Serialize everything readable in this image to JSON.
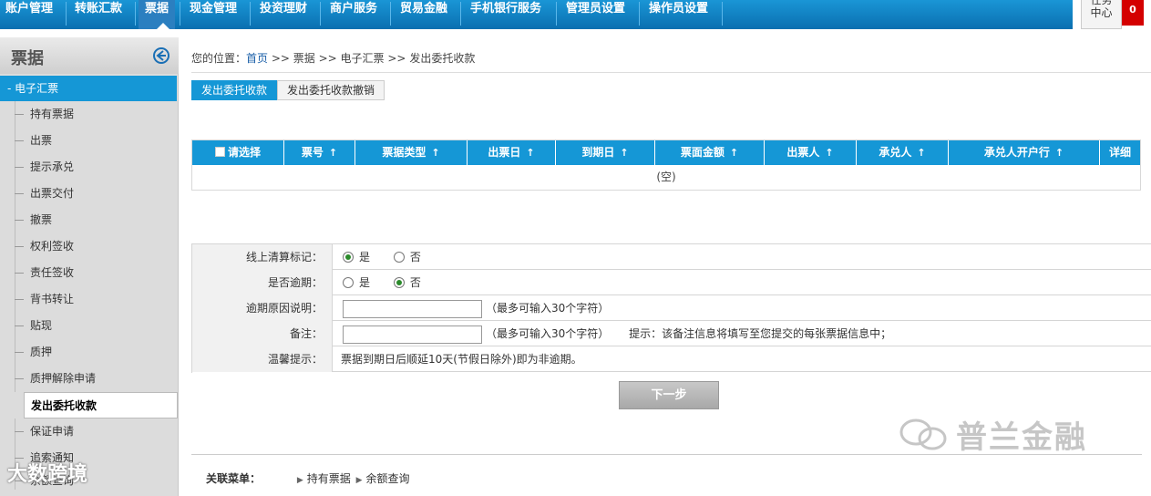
{
  "topnav": {
    "items": [
      "账户管理",
      "转账汇款",
      "票据",
      "现金管理",
      "投资理财",
      "商户服务",
      "贸易金融",
      "手机银行服务",
      "管理员设置",
      "操作员设置"
    ],
    "task_line1": "任务",
    "task_line2": "中心",
    "task_count": "0"
  },
  "sidebar": {
    "title": "票据",
    "section": "- 电子汇票",
    "items": [
      "持有票据",
      "出票",
      "提示承兑",
      "出票交付",
      "撤票",
      "权利签收",
      "责任签收",
      "背书转让",
      "贴现",
      "质押",
      "质押解除申请",
      "发出委托收款",
      "保证申请",
      "追索通知",
      "余额查询"
    ]
  },
  "breadcrumb": {
    "prefix": "您的位置：",
    "home": "首页",
    "sep": " >> ",
    "level1": "票据",
    "level2": "电子汇票",
    "level3": "发出委托收款"
  },
  "tabs": [
    "发出委托收款",
    "发出委托收款撤销"
  ],
  "table": {
    "select_all": "请选择",
    "columns": [
      "票号",
      "票据类型",
      "出票日",
      "到期日",
      "票面金额",
      "出票人",
      "承兑人",
      "承兑人开户行"
    ],
    "detail": "详细",
    "sort_arrow": "↑",
    "empty": "(空)"
  },
  "form": {
    "settle_label": "线上清算标记：",
    "overdue_label": "是否逾期：",
    "reason_label": "逾期原因说明：",
    "remark_label": "备注：",
    "tip_label": "温馨提示：",
    "yes": "是",
    "no": "否",
    "limit_hint": "（最多可输入30个字符）",
    "remark_tip": "提示：该备注信息将填写至您提交的每张票据信息中；",
    "tip_text": "票据到期日后顺延10天(节假日除外)即为非逾期。"
  },
  "next_button": "下一步",
  "related": {
    "label": "关联菜单：",
    "links": [
      "持有票据",
      "余额查询"
    ]
  },
  "watermarks": {
    "right": "普兰金融",
    "left": "大数跨境"
  },
  "colors": {
    "nav_blue": "#0a6fb0",
    "accent_blue": "#1597d6",
    "badge_red": "#d40000"
  }
}
